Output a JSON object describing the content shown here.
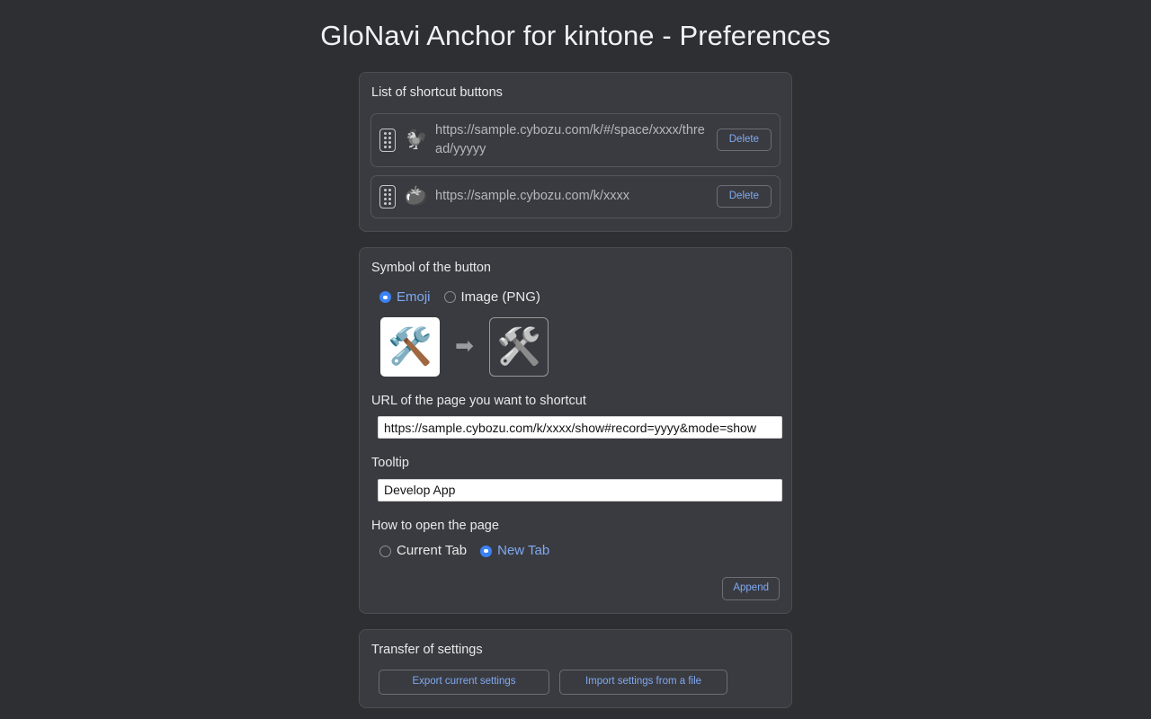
{
  "page": {
    "title": "GloNavi Anchor for kintone - Preferences",
    "background_color": "#2e2f33",
    "panel_color": "#3a3b40",
    "accent_color": "#7fa9f2",
    "radio_on_color": "#3b82f6"
  },
  "shortcut_list": {
    "title": "List of shortcut buttons",
    "items": [
      {
        "drag_handle": "drag-handle-icon",
        "emoji": "🐓",
        "url": "https://sample.cybozu.com/k/#/space/xxxx/thread/yyyyy",
        "delete_label": "Delete"
      },
      {
        "drag_handle": "drag-handle-icon",
        "emoji": "🍅",
        "url": "https://sample.cybozu.com/k/xxxx",
        "delete_label": "Delete"
      }
    ]
  },
  "symbol": {
    "title": "Symbol of the button",
    "type_options": [
      {
        "label": "Emoji",
        "selected": true
      },
      {
        "label": "Image (PNG)",
        "selected": false
      }
    ],
    "emoji_value": "🛠️",
    "arrow_icon": "➡",
    "preview_emoji": "🛠️",
    "url_label": "URL of the page you want to shortcut",
    "url_value": "https://sample.cybozu.com/k/xxxx/show#record=yyyy&mode=show",
    "url_placeholder": "",
    "tooltip_label": "Tooltip",
    "tooltip_value": "Develop App",
    "tooltip_placeholder": "",
    "open_label": "How to open the page",
    "open_options": [
      {
        "label": "Current Tab",
        "selected": false
      },
      {
        "label": "New Tab",
        "selected": true
      }
    ],
    "append_label": "Append"
  },
  "transfer": {
    "title": "Transfer of settings",
    "export_label": "Export current settings",
    "import_label": "Import settings from a file"
  }
}
